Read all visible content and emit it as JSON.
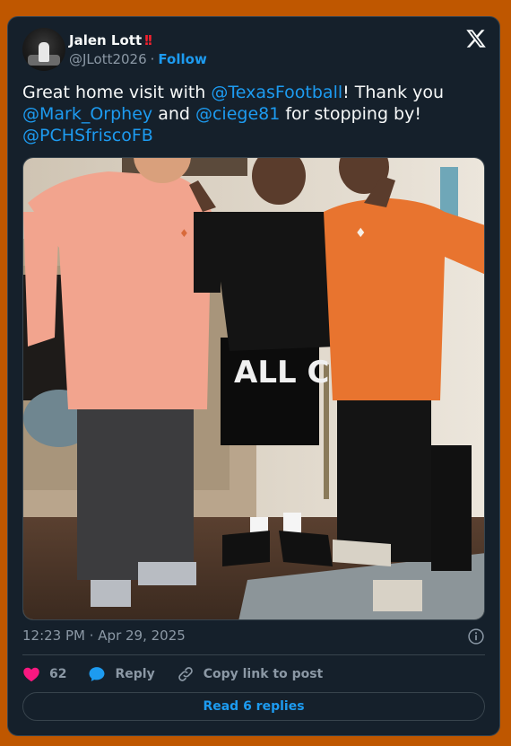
{
  "author": {
    "display_name": "Jalen Lott",
    "badge": "!!",
    "handle": "@JLott2026",
    "separator": "·",
    "follow_label": "Follow"
  },
  "tweet": {
    "text_segments": [
      {
        "text": "Great home visit with ",
        "type": "text"
      },
      {
        "text": "@TexasFootball",
        "type": "mention"
      },
      {
        "text": "! Thank you ",
        "type": "text"
      },
      {
        "text": "@Mark_Orphey",
        "type": "mention"
      },
      {
        "text": " and ",
        "type": "text"
      },
      {
        "text": "@ciege81",
        "type": "mention"
      },
      {
        "text": " for stopping by! ",
        "type": "text"
      },
      {
        "text": "@PCHSfriscoFB",
        "type": "mention"
      }
    ],
    "timestamp": "12:23 PM · Apr 29, 2025",
    "photo_shorts_text": "ALL CITY"
  },
  "actions": {
    "like_count": "62",
    "reply_label": "Reply",
    "copy_link_label": "Copy link to post"
  },
  "read_replies_label": "Read 6 replies",
  "icons": {
    "platform": "x-logo-icon",
    "info": "info-icon",
    "like": "heart-icon",
    "reply": "speech-bubble-icon",
    "copy_link": "link-icon"
  },
  "colors": {
    "page_background": "#bf5700",
    "card_background": "#15202b",
    "mention": "#1d9bf0",
    "like": "#f91880",
    "verified_badge": "#f4212e"
  }
}
